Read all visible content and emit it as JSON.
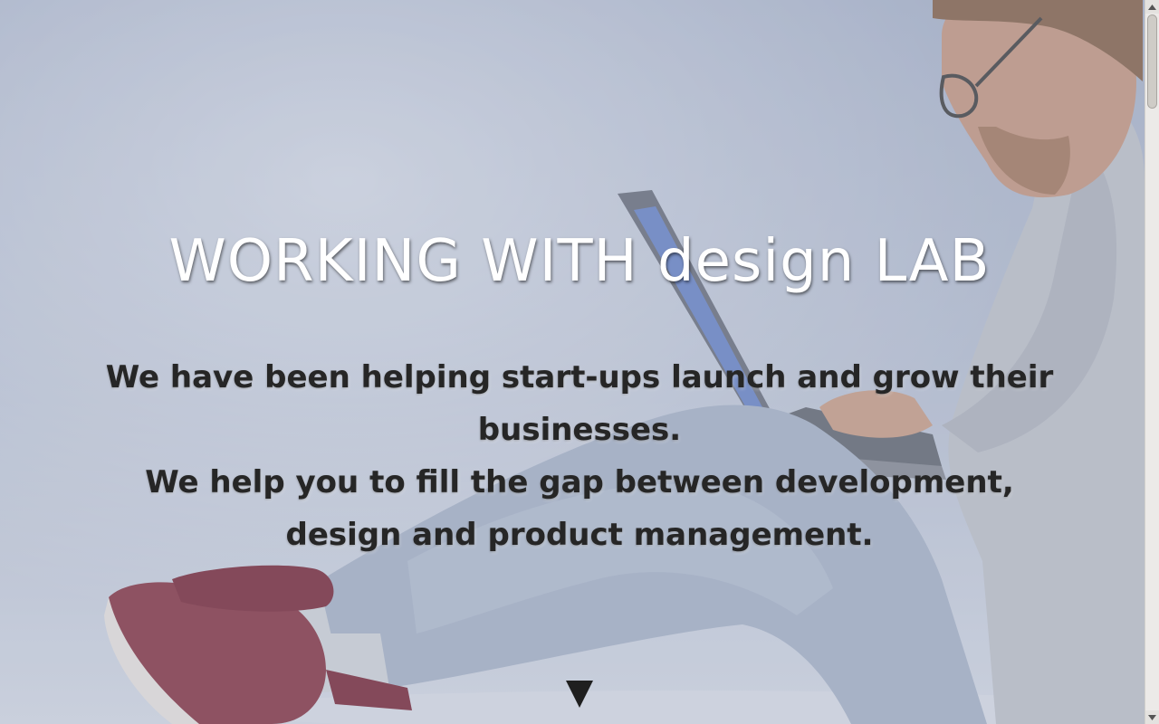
{
  "hero": {
    "headline": "WORKING WITH design LAB",
    "tagline": {
      "line1": "We have been helping start-ups launch and grow their businesses.",
      "line2": "We help you to fill the gap between development, design and product management."
    },
    "background_image": "person-with-laptop",
    "scroll_icon": "triangle-down-icon"
  },
  "colors": {
    "headline": "#ffffff",
    "tagline": "#262626",
    "background": "#b3bccd"
  }
}
